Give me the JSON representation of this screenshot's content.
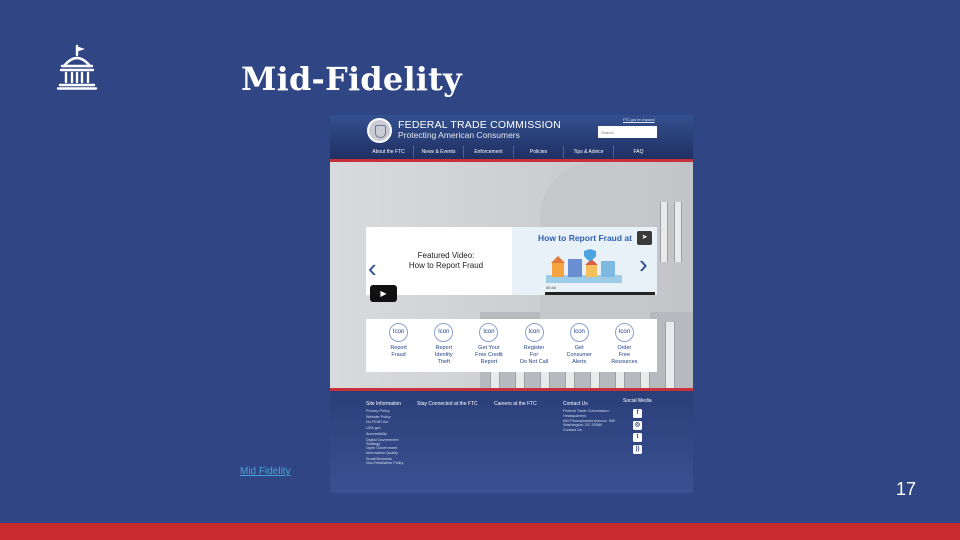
{
  "slide": {
    "title": "Mid-Fidelity",
    "link_text": "Mid Fidelity",
    "page_number": "17",
    "icon": "capitol-building-icon"
  },
  "mockup": {
    "header": {
      "org_name": "FEDERAL TRADE COMMISSION",
      "tagline": "Protecting American Consumers",
      "lang_link": "FTC.gov en espanol",
      "search_placeholder": "Search"
    },
    "nav": [
      "About the FTC",
      "News & Events",
      "Enforcement",
      "Policies",
      "Tips & Advice",
      "FAQ"
    ],
    "feature": {
      "text_line1": "Featured Video:",
      "text_line2": "How to Report Fraud",
      "video_title": "How to Report Fraud at",
      "timecode": "00:40"
    },
    "actions": [
      {
        "icon_label": "Icon",
        "label": "Report\nFraud"
      },
      {
        "icon_label": "Icon",
        "label": "Report\nIdentity\nTheft"
      },
      {
        "icon_label": "Icon",
        "label": "Get Your\nFree Credit\nReport"
      },
      {
        "icon_label": "Icon",
        "label": "Register\nFor\nDo Not Call"
      },
      {
        "icon_label": "Icon",
        "label": "Get\nConsumer\nAlerts"
      },
      {
        "icon_label": "Icon",
        "label": "Order\nFree\nResources"
      }
    ],
    "footer": {
      "col1_head": "Site Information",
      "col2_head": "Stay Connected at the FTC",
      "col3_head": "Careers at the FTC",
      "col4_head": "Contact Us",
      "col5_head": "Social Media",
      "site_info_links": [
        "Privacy Policy",
        "Website Policy",
        "No FEAR Act",
        "USA.gov",
        "Accessibility",
        "Digital Government",
        "Strategy",
        "Open Government",
        "Information Quality",
        "Small Business",
        "Non-Retaliation Policy"
      ],
      "contact_lines": [
        "Federal Trade Commission",
        "Headquarters",
        "600 Pennsylvania Avenue, NW",
        "Washington, DC 20580",
        "Contact Us"
      ]
    }
  },
  "colors": {
    "slide_bg": "#304684",
    "accent_red": "#c82a2e",
    "link": "#46a3d8"
  }
}
